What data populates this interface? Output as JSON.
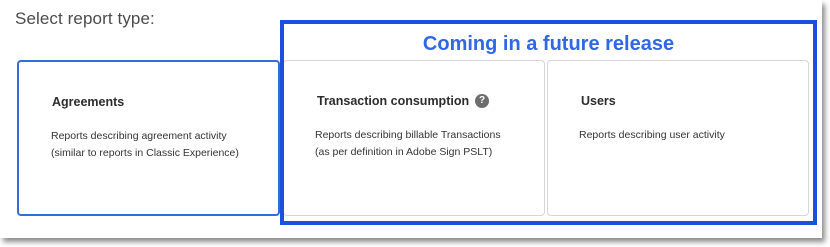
{
  "heading": "Select report type:",
  "annotation": {
    "label": "Coming in a future release",
    "color": "#1d4fe0"
  },
  "cards": [
    {
      "title": "Agreements",
      "desc_line1": "Reports describing agreement activity",
      "desc_line2": "(similar to reports in Classic Experience)",
      "selected": true
    },
    {
      "title": "Transaction consumption",
      "desc_line1": "Reports describing billable Transactions",
      "desc_line2": "(as per definition in Adobe Sign PSLT)",
      "help_icon": "question-circle-icon",
      "help_glyph": "?"
    },
    {
      "title": "Users",
      "desc_line1": "Reports describing user activity",
      "desc_line2": ""
    }
  ],
  "colors": {
    "selected_border": "#2f6fd8",
    "card_border": "#d6d6d6"
  }
}
